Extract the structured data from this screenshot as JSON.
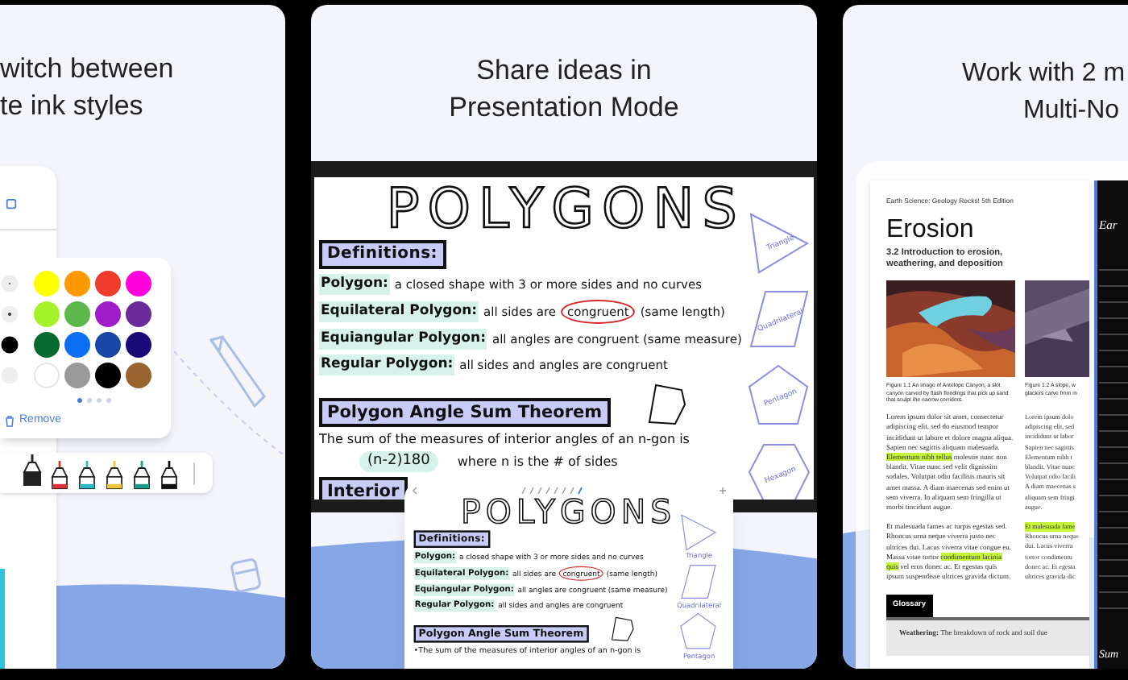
{
  "ink_panel": {
    "heading_lines": [
      "witch between",
      "te ink styles"
    ],
    "swatches": [
      {
        "color": "#ffff00"
      },
      {
        "color": "#ff9900"
      },
      {
        "color": "#f03a2a"
      },
      {
        "color": "#ff00dd"
      },
      {
        "color": "#a6f22a"
      },
      {
        "color": "#5cb84a"
      },
      {
        "color": "#a01cc8"
      },
      {
        "color": "#6a2a9a"
      },
      {
        "color": "#086a2e"
      },
      {
        "color": "#0a6ef0"
      },
      {
        "color": "#1a46a8"
      },
      {
        "color": "#1a0a78"
      },
      {
        "color": "#ffffff"
      },
      {
        "color": "#9a9a9a"
      },
      {
        "color": "#000000"
      },
      {
        "color": "#9a6430"
      }
    ],
    "page_dots": [
      {
        "selected": true
      },
      {
        "selected": false
      },
      {
        "selected": false
      },
      {
        "selected": false
      }
    ],
    "remove_label": "Remove",
    "pens": [
      {
        "color": "#222222",
        "selected": true
      },
      {
        "color": "#d8343a",
        "selected": false
      },
      {
        "color": "#2bb5c8",
        "selected": false
      },
      {
        "color": "#f0c43a",
        "selected": false
      },
      {
        "color": "#1a9a8a",
        "selected": false
      },
      {
        "color": "#111111",
        "selected": false
      }
    ]
  },
  "presentation_panel": {
    "heading_lines": [
      "Share ideas in",
      "Presentation Mode"
    ],
    "board": {
      "title": "POLYGONS",
      "definitions_heading": "Definitions:",
      "definitions": [
        {
          "term": "Polygon:",
          "segments": [
            {
              "text": "a closed shape with 3 or more sides and no curves",
              "circled": false
            }
          ]
        },
        {
          "term": "Equilateral Polygon:",
          "segments": [
            {
              "text": "all sides are",
              "circled": false
            },
            {
              "text": "congruent",
              "circled": true
            },
            {
              "text": "(same length)",
              "circled": false
            }
          ]
        },
        {
          "term": "Equiangular Polygon:",
          "segments": [
            {
              "text": "all angles are congruent (same measure)",
              "circled": false
            }
          ]
        },
        {
          "term": "Regular Polygon:",
          "segments": [
            {
              "text": "all sides and angles are congruent",
              "circled": false
            }
          ]
        }
      ],
      "theorem_heading": "Polygon Angle Sum Theorem",
      "theorem_lines": [
        "The sum of the measures of interior angles of an n-gon is"
      ],
      "formula": "(n-2)180",
      "formula_rest": "where n is the # of sides",
      "next_heading": "Interior",
      "shapes": [
        "Triangle",
        "Quadrilateral",
        "Pentagon",
        "Hexagon"
      ]
    },
    "mini_board": {
      "title": "POLYGONS",
      "definitions_heading": "Definitions:",
      "definitions": [
        {
          "term": "Polygon:",
          "segments": [
            {
              "text": "a closed shape with 3 or more sides and no curves",
              "circled": false
            }
          ]
        },
        {
          "term": "Equilateral Polygon:",
          "segments": [
            {
              "text": "all sides are",
              "circled": false
            },
            {
              "text": "congruent",
              "circled": true
            },
            {
              "text": "(same length)",
              "circled": false
            }
          ]
        },
        {
          "term": "Equiangular Polygon:",
          "segments": [
            {
              "text": "all angles are congruent (same measure)",
              "circled": false
            }
          ]
        },
        {
          "term": "Regular Polygon:",
          "segments": [
            {
              "text": "all sides and angles are congruent",
              "circled": false
            }
          ]
        }
      ],
      "theorem_heading": "Polygon Angle Sum Theorem",
      "theorem_lines": [
        "•The sum of the measures of interior angles of an n-gon is"
      ],
      "shapes": [
        "Triangle",
        "Quadrilateral",
        "Pentagon"
      ]
    }
  },
  "multi_note_panel": {
    "heading_lines": [
      "Work with 2 m",
      "Multi-No"
    ],
    "document": {
      "source": "Earth Science: Geology Rocks! 5th Edition",
      "title": "Erosion",
      "subtitle": "3.2 Introduction to erosion, weathering, and deposition",
      "captions": [
        "Figure 1.1 An image of Antelope Canyon, a slot canyon carved by flash floodings that pick up sand that sculpt the narrow corridors.",
        "Figure 1.2 A slope, w",
        "glaciers carve from m"
      ],
      "paragraphs": [
        {
          "segments": [
            {
              "text": "Lorem ipsum dolor sit amet, consectetur adipiscing elit, sed do eiusmod tempor incididunt ut labore et dolore magna aliqua. Sapien nec sagittis aliquam malesuada.",
              "highlight": false
            },
            {
              "text": "Elementum nibh tellus",
              "highlight": true
            },
            {
              "text": "molestie nunc non blandit. Vitae nunc sed velit dignissim sodales. Volutpat odio facilisis mauris sit amet massa. A diam maecenas sed enim ut sem viverra. In aliquam sem fringilla ut morbi tincidunt augue.",
              "highlight": false
            }
          ]
        },
        {
          "segments": [
            {
              "text": "Et malesuada fames ac turpis egestas sed. Rhoncus urna neque viverra justo nec ultrices dui. Lacus viverra vitae congue eu. Massa vitae tortor",
              "highlight": false
            },
            {
              "text": "condimentum lacinia quis",
              "highlight": true
            },
            {
              "text": "vel eros donec ac. Et egestas quis ipsum suspendisse ultrices gravida dictum.",
              "highlight": false
            }
          ]
        }
      ],
      "column_2_lines": [
        {
          "text": "Lorem ipsum dolo",
          "highlight": false
        },
        {
          "text": "adipiscing elit, sed",
          "highlight": false
        },
        {
          "text": "incididunt ut labor",
          "highlight": false
        },
        {
          "text": "Sapien nec sagittis",
          "highlight": false
        },
        {
          "text": "Elementum nibh t",
          "highlight": false
        },
        {
          "text": "blandit. Vitae nunc",
          "highlight": false
        },
        {
          "text": "Volutpat odio facili",
          "highlight": false
        },
        {
          "text": "A diam maecenas s",
          "highlight": false
        },
        {
          "text": "aliquam sem fringi",
          "highlight": false
        },
        {
          "text": "augue.",
          "highlight": false
        },
        {
          "text": "Et malesuada fame",
          "highlight": true
        },
        {
          "text": "Rhoncus urna neque",
          "highlight": false
        },
        {
          "text": "dui. Lacus viverra",
          "highlight": false
        },
        {
          "text": "tortor condimentu",
          "highlight": false
        },
        {
          "text": "donec ac. Et egesta",
          "highlight": false
        },
        {
          "text": "ultrices gravida dic",
          "highlight": false
        }
      ],
      "glossary_tab": "Glossary",
      "glossary_text": "**Weathering:** The breakdown of rock and soil due"
    },
    "notebook": {
      "title": "Ear",
      "footer": "Sum"
    }
  }
}
